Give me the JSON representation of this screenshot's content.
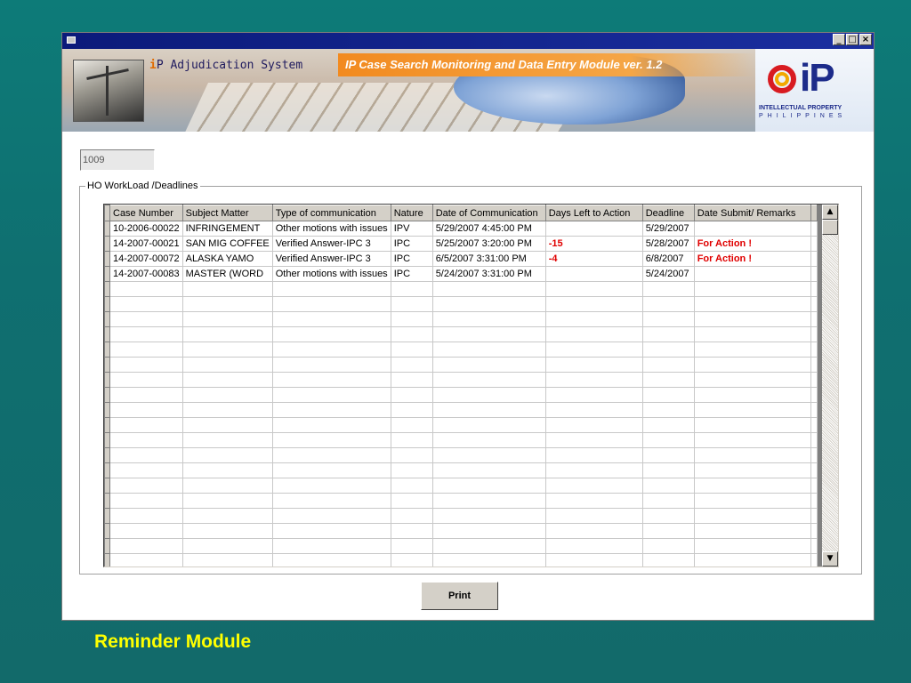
{
  "window": {
    "controls": [
      "_",
      "□",
      "×"
    ]
  },
  "banner": {
    "app_title_prefix": "i",
    "app_title_rest": "P Adjudication System",
    "module_title": "IP Case Search Monitoring and Data Entry Module ver. 1.2",
    "logo_text": "iP",
    "logo_line1": "INTELLECTUAL PROPERTY",
    "logo_line2": "PHILIPPINES"
  },
  "id_field": {
    "value": "1009"
  },
  "workload": {
    "legend": "HO WorkLoad /Deadlines",
    "columns": [
      "Case Number",
      "Subject Matter",
      "Type of communication",
      "Nature",
      "Date of Communication",
      "Days Left to Action",
      "Deadline",
      "Date Submit/ Remarks"
    ],
    "rows": [
      [
        "10-2006-00022",
        "INFRINGEMENT",
        "Other motions with issues",
        "IPV",
        "5/29/2007 4:45:00 PM",
        "",
        "5/29/2007",
        ""
      ],
      [
        "14-2007-00021",
        "SAN MIG COFFEE",
        "Verified Answer-IPC 3",
        "IPC",
        "5/25/2007 3:20:00 PM",
        "-15",
        "5/28/2007",
        "For Action !"
      ],
      [
        "14-2007-00072",
        "ALASKA YAMO",
        "Verified Answer-IPC 3",
        "IPC",
        "6/5/2007 3:31:00 PM",
        "-4",
        "6/8/2007",
        "For Action !"
      ],
      [
        "14-2007-00083",
        "MASTER (WORD",
        "Other motions with issues",
        "IPC",
        "5/24/2007 3:31:00 PM",
        "",
        "5/24/2007",
        ""
      ]
    ],
    "alert_color": "#e00000"
  },
  "print_label": "Print",
  "caption": "Reminder Module",
  "colors": {
    "background": "#0f7070",
    "caption": "#ffff00",
    "titlebar": "#0b1a7a",
    "module_bar": "#f28a1f"
  }
}
